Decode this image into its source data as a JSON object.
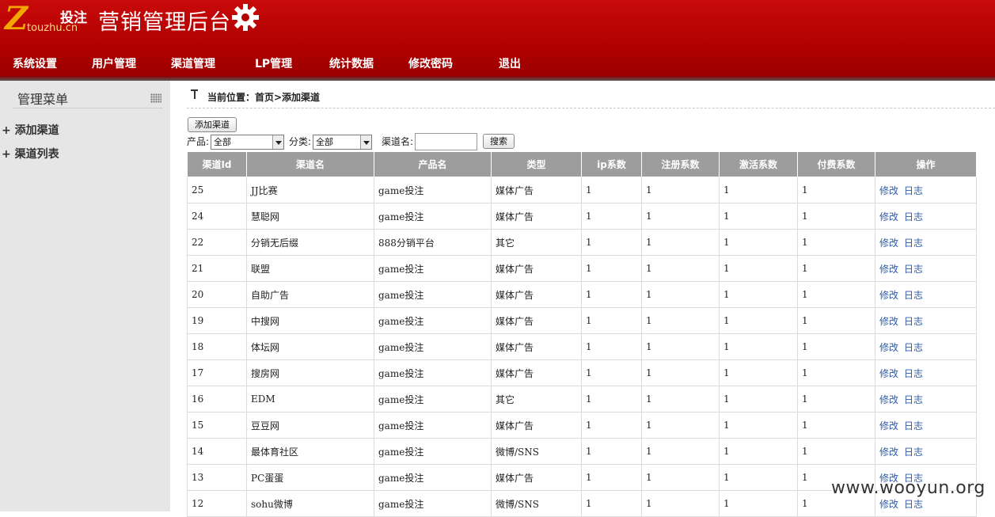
{
  "header": {
    "logo_z": "Z",
    "logo_cn": "投注",
    "logo_domain": "touzhu.cn",
    "title": "营销管理后台"
  },
  "nav": [
    "系统设置",
    "用户管理",
    "渠道管理",
    "LP管理",
    "统计数据",
    "修改密码",
    "退出"
  ],
  "sidebar": {
    "title": "管理菜单",
    "items": [
      "+ 添加渠道",
      "+ 渠道列表"
    ]
  },
  "breadcrumb": "当前位置：首页>添加渠道",
  "toolbar": {
    "add_button": "添加渠道",
    "product_label": "产品:",
    "product_value": "全部",
    "category_label": "分类:",
    "category_value": "全部",
    "channel_name_label": "渠道名:",
    "channel_name_value": "",
    "search_button": "搜索"
  },
  "table": {
    "headers": [
      "渠道Id",
      "渠道名",
      "产品名",
      "类型",
      "ip系数",
      "注册系数",
      "激活系数",
      "付费系数",
      "操作"
    ],
    "action_edit": "修改",
    "action_log": "日志",
    "rows": [
      [
        "25",
        "JJ比赛",
        "game投注",
        "媒体广告",
        "1",
        "1",
        "1",
        "1"
      ],
      [
        "24",
        "慧聪网",
        "game投注",
        "媒体广告",
        "1",
        "1",
        "1",
        "1"
      ],
      [
        "22",
        "分销无后缀",
        "888分销平台",
        "其它",
        "1",
        "1",
        "1",
        "1"
      ],
      [
        "21",
        "联盟",
        "game投注",
        "媒体广告",
        "1",
        "1",
        "1",
        "1"
      ],
      [
        "20",
        "自助广告",
        "game投注",
        "媒体广告",
        "1",
        "1",
        "1",
        "1"
      ],
      [
        "19",
        "中搜网",
        "game投注",
        "媒体广告",
        "1",
        "1",
        "1",
        "1"
      ],
      [
        "18",
        "体坛网",
        "game投注",
        "媒体广告",
        "1",
        "1",
        "1",
        "1"
      ],
      [
        "17",
        "搜房网",
        "game投注",
        "媒体广告",
        "1",
        "1",
        "1",
        "1"
      ],
      [
        "16",
        "EDM",
        "game投注",
        "其它",
        "1",
        "1",
        "1",
        "1"
      ],
      [
        "15",
        "豆豆网",
        "game投注",
        "媒体广告",
        "1",
        "1",
        "1",
        "1"
      ],
      [
        "14",
        "最体育社区",
        "game投注",
        "微博/SNS",
        "1",
        "1",
        "1",
        "1"
      ],
      [
        "13",
        "PC蛋蛋",
        "game投注",
        "媒体广告",
        "1",
        "1",
        "1",
        "1"
      ],
      [
        "12",
        "sohu微博",
        "game投注",
        "微博/SNS",
        "1",
        "1",
        "1",
        "1"
      ]
    ]
  },
  "watermark": "www.wooyun.org"
}
